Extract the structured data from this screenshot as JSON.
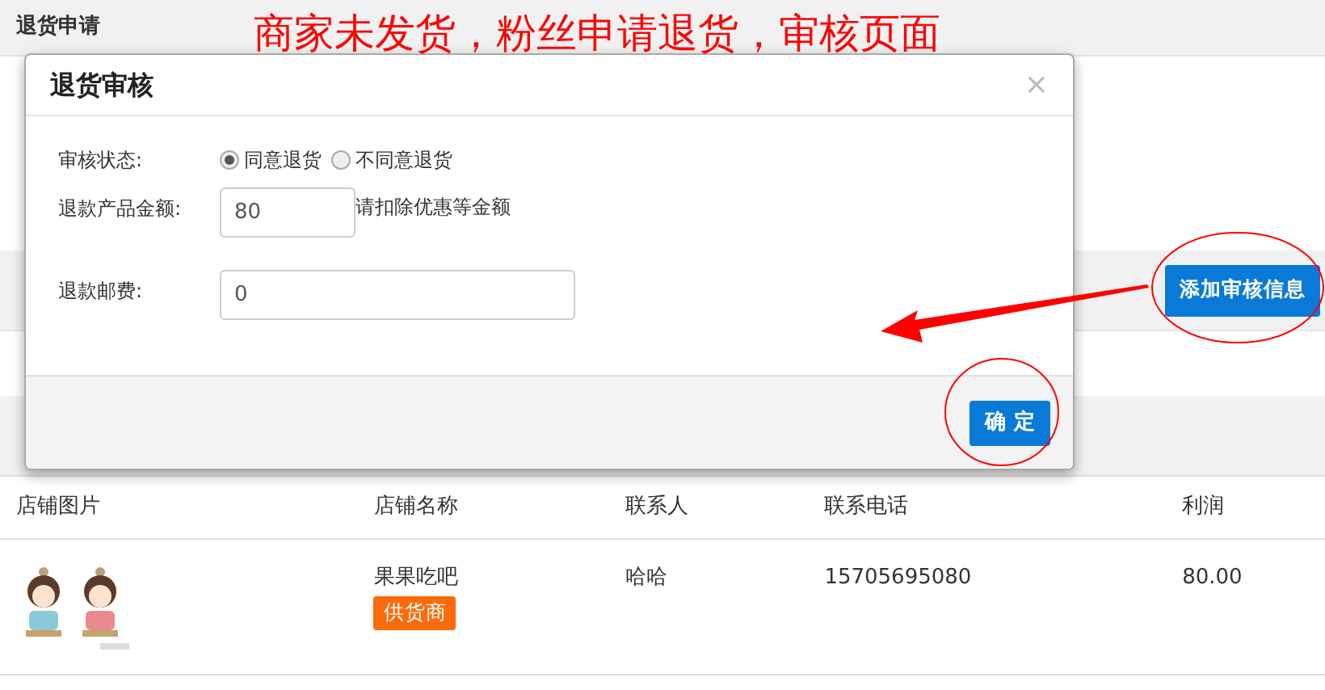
{
  "page": {
    "title": "退货申请",
    "section_button": "添加审核信息",
    "table": {
      "columns": [
        "店铺图片",
        "店铺名称",
        "联系人",
        "联系电话",
        "利润"
      ],
      "rows": [
        {
          "shop_name": "果果吃吧",
          "tag": "供货商",
          "contact": "哈哈",
          "phone": "15705695080",
          "profit": "80.00"
        }
      ]
    }
  },
  "modal": {
    "title": "退货审核",
    "close": "×",
    "fields": [
      {
        "kind": "radio",
        "label": "审核状态:",
        "options": [
          {
            "label": "同意退货",
            "selected": true
          },
          {
            "label": "不同意退货",
            "selected": false
          }
        ]
      },
      {
        "kind": "input",
        "label": "退款产品金额:",
        "value": "80",
        "hint": "请扣除优惠等金额"
      },
      {
        "kind": "input",
        "label": "退款邮费:",
        "value": "0"
      }
    ],
    "confirm": "确 定"
  },
  "annotation": {
    "caption": "商家未发货，粉丝申请退货，审核页面"
  }
}
